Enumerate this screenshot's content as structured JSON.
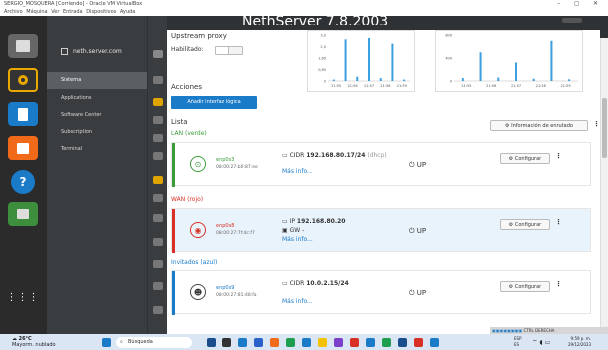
{
  "window": {
    "title": "SERGIO_MOSQUERA [Corriendo] - Oracle VM VirtualBox",
    "menu": "Archivo  Máquina  Ver  Entrada  Dispositivos  Ayuda",
    "controls": "– ◻ ✕"
  },
  "app": {
    "title": "NethServer 7.8.2003",
    "server": "neth.server.com",
    "nav": [
      "Sistema",
      "Applications",
      "Software Center",
      "Subscription",
      "Terminal"
    ],
    "active_nav": "Sistema"
  },
  "proxy": {
    "heading": "Upstream proxy",
    "enabled_label": "Habilitado:"
  },
  "actions": {
    "heading": "Acciones",
    "add_button": "Añadir interfaz lógica"
  },
  "chart_data": [
    {
      "type": "bar",
      "title": "",
      "x": [
        "21:55",
        "21:56",
        "21:57",
        "21:58",
        "21:59"
      ],
      "yticks": [
        "3,0",
        "2,0",
        "1,60",
        "0,80",
        "0"
      ],
      "ylim": [
        0,
        3.2
      ],
      "values": [
        0.1,
        2.9,
        0.3,
        3.0,
        0.2,
        2.6,
        0.1
      ]
    },
    {
      "type": "bar",
      "title": "",
      "x": [
        "21:55",
        "21:56",
        "21:57",
        "21:58",
        "21:59"
      ],
      "yticks": [
        "800",
        "400",
        "0"
      ],
      "ylim": [
        0,
        800
      ],
      "values": [
        50,
        500,
        60,
        320,
        40,
        700,
        30
      ]
    }
  ],
  "list": {
    "heading": "Lista",
    "info_button": "Información de enrutado"
  },
  "zones": [
    {
      "name": "LAN (verde)",
      "color": "#3a9c3a",
      "device": "enp0s3",
      "mac": "08:00:27:b0:87:ee",
      "addr_prefix": "CIDR",
      "addr": "192.168.80.17/24",
      "dhcp": "(dhcp)",
      "gw": "",
      "more": "Más info...",
      "status": "UP",
      "config": "Configurar"
    },
    {
      "name": "WAN (rojo)",
      "color": "#d93025",
      "device": "enp0s8",
      "mac": "08:00:27:7f:dc:f7",
      "addr_prefix": "IP",
      "addr": "192.168.80.20",
      "dhcp": "",
      "gw": "GW  -",
      "more": "Más info...",
      "status": "UP",
      "config": "Configurar"
    },
    {
      "name": "Invitados (azul)",
      "color": "#1a7bc9",
      "device": "enp0s9",
      "mac": "08:00:27:81:48:fa",
      "addr_prefix": "CIDR",
      "addr": "10.0.2.15/24",
      "dhcp": "",
      "gw": "",
      "more": "Más info...",
      "status": "UP",
      "config": "Configurar"
    }
  ],
  "taskbar": {
    "weather_temp": "26°C",
    "weather_desc": "Mayorm. nublado",
    "search": "Búsqueda",
    "lang1": "ESP",
    "lang2": "ES",
    "time": "9:59 p. m.",
    "date": "29/12/2023",
    "tray_text": "CTRL DERECHA"
  }
}
